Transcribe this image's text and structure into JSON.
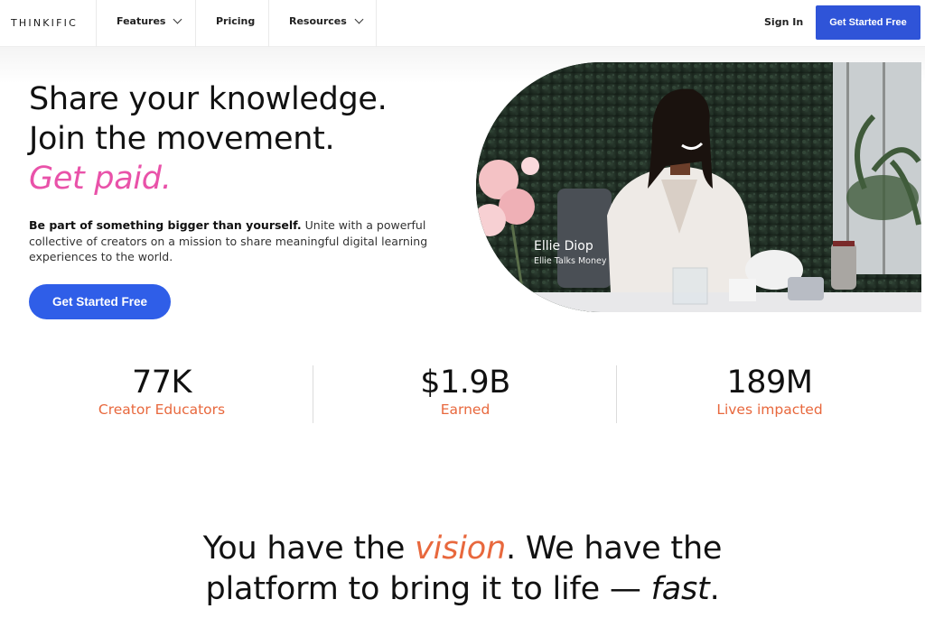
{
  "nav": {
    "logo": "THINKIFIC",
    "items": [
      {
        "label": "Features"
      },
      {
        "label": "Pricing"
      },
      {
        "label": "Resources"
      }
    ],
    "sign_in": "Sign In",
    "cta": "Get Started Free"
  },
  "hero": {
    "line1": "Share your knowledge.",
    "line2": "Join the movement.",
    "line3": "Get paid.",
    "sub_bold": "Be part of something bigger than yourself.",
    "sub_rest": " Unite with a powerful collective of creators on a mission to share meaningful digital learning experiences to the world.",
    "cta": "Get Started Free",
    "photo_name": "Ellie Diop",
    "photo_sub": "Ellie Talks Money"
  },
  "stats": [
    {
      "value": "77K",
      "label": "Creator Educators"
    },
    {
      "value": "$1.9B",
      "label": "Earned"
    },
    {
      "value": "189M",
      "label": "Lives impacted"
    }
  ],
  "vision": {
    "part1": "You have the ",
    "accent": "vision",
    "part2": ". We have the",
    "line2": "platform to bring it to life — ",
    "fast": "fast",
    "end": "."
  },
  "colors": {
    "brand_blue": "#2f54d8",
    "accent_pink": "#e952a9",
    "accent_orange": "#e8683d"
  }
}
